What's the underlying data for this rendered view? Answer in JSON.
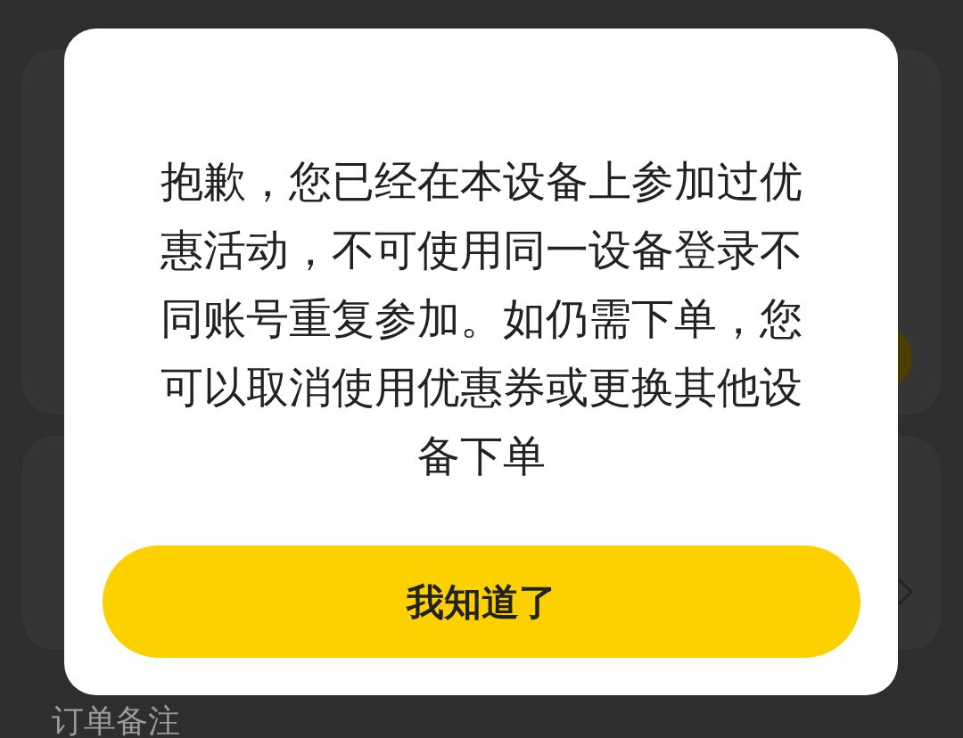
{
  "background": {
    "note_label": "订单备注"
  },
  "dialog": {
    "message": "抱歉，您已经在本设备上参加过优惠活动，不可使用同一设备登录不同账号重复参加。如仍需下单，您可以取消使用优惠券或更换其他设备下单",
    "button": "我知道了"
  }
}
